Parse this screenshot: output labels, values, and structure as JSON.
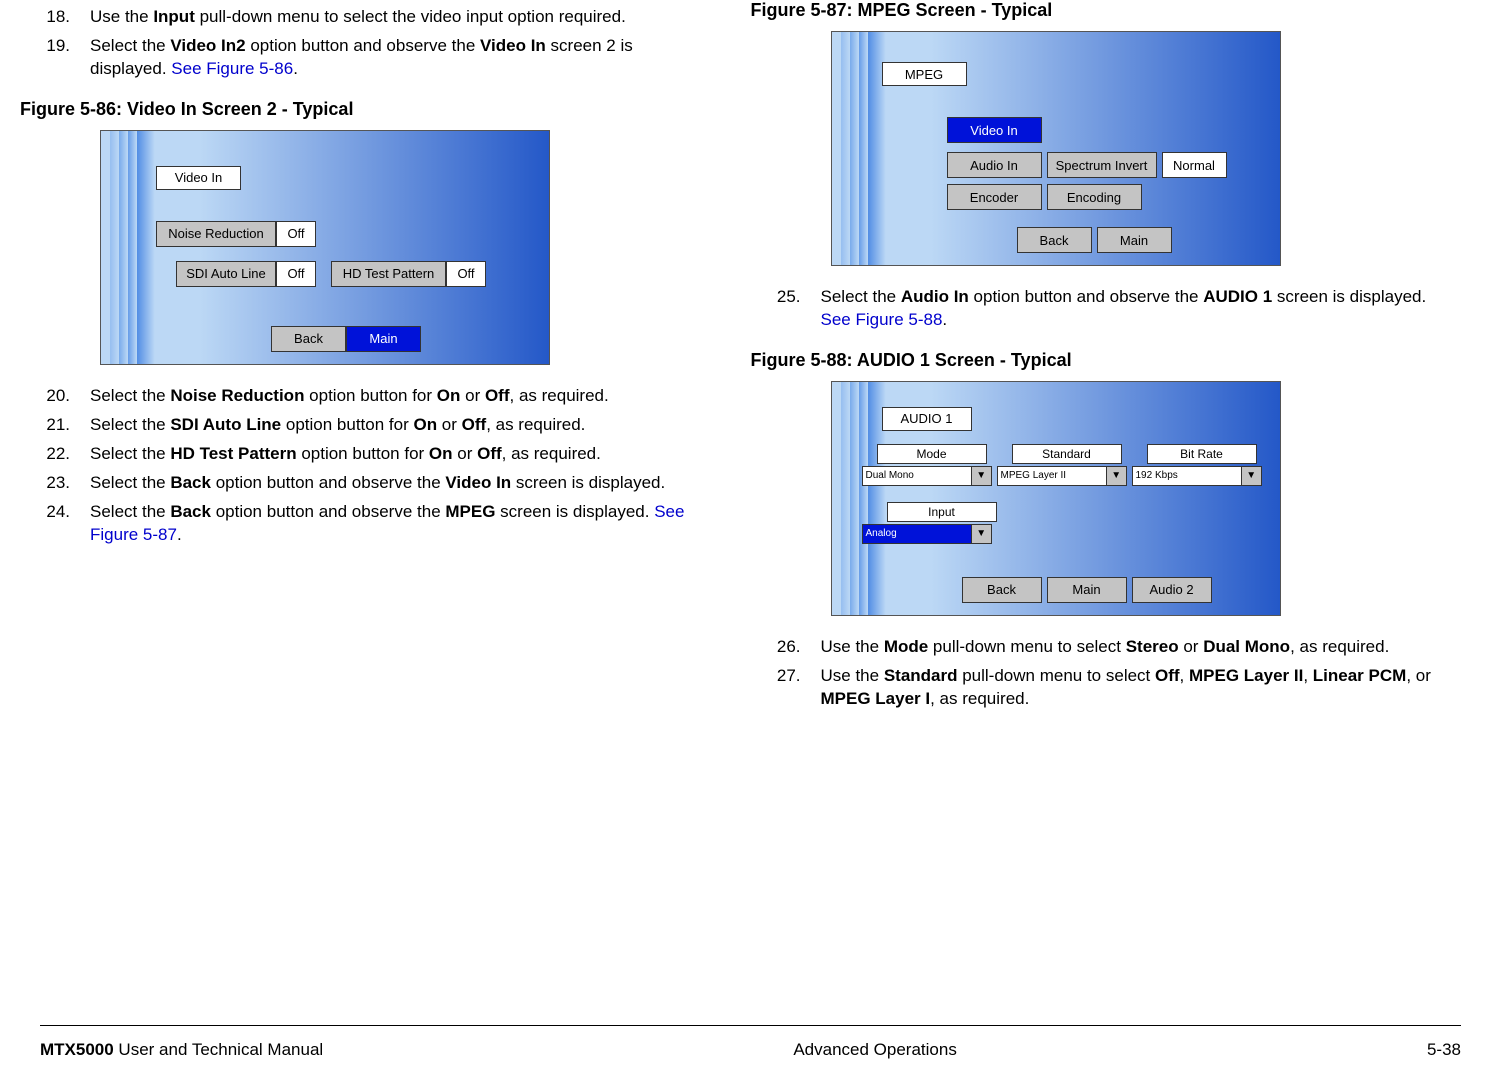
{
  "left": {
    "steps_a": [
      {
        "num": "18.",
        "html": "Use the <b>Input</b> pull-down menu to select the video input option required."
      },
      {
        "num": "19.",
        "html": "Select the <b>Video In2</b> option button and observe the <b>Video In</b> screen 2 is displayed.  <span class='link'>See Figure 5-86</span>."
      }
    ],
    "fig86_title": "Figure 5-86:   Video In Screen 2 - Typical",
    "fig86": {
      "tab": "Video In",
      "noise_reduction": "Noise Reduction",
      "off1": "Off",
      "sdi": "SDI Auto Line",
      "off2": "Off",
      "hdtest": "HD Test Pattern",
      "off3": "Off",
      "back": "Back",
      "main": "Main"
    },
    "steps_b": [
      {
        "num": "20.",
        "html": "Select the <b>Noise Reduction</b> option button for <b>On</b> or <b>Off</b>, as required."
      },
      {
        "num": "21.",
        "html": "Select the <b>SDI Auto Line</b> option button for <b>On</b> or <b>Off</b>, as required."
      },
      {
        "num": "22.",
        "html": "Select the <b>HD Test Pattern</b> option button for <b>On</b> or <b>Off</b>, as required."
      },
      {
        "num": "23.",
        "html": "Select the <b>Back</b> option button and observe the <b>Video In</b> screen is displayed."
      },
      {
        "num": "24.",
        "html": "Select the <b>Back</b> option button and observe the <b>MPEG</b> screen is displayed.  <span class='link'>See Figure 5-87</span>."
      }
    ]
  },
  "right": {
    "fig87_title": "Figure 5-87:   MPEG Screen - Typical",
    "fig87": {
      "mpeg": "MPEG",
      "video_in": "Video In",
      "audio_in": "Audio In",
      "spec": "Spectrum Invert",
      "normal": "Normal",
      "encoder": "Encoder",
      "encoding": "Encoding",
      "back": "Back",
      "main": "Main"
    },
    "steps_a": [
      {
        "num": "25.",
        "html": "Select the <b>Audio In</b> option button and observe the <b>AUDIO 1</b> screen is displayed.  <span class='link'>See Figure 5-88</span>."
      }
    ],
    "fig88_title": "Figure 5-88:   AUDIO 1 Screen - Typical",
    "fig88": {
      "tab": "AUDIO 1",
      "mode": "Mode",
      "standard": "Standard",
      "bitrate": "Bit Rate",
      "dual": "Dual Mono",
      "layer": "MPEG Layer II",
      "kbps": "192 Kbps",
      "input": "Input",
      "analog": "Analog",
      "back": "Back",
      "main": "Main",
      "audio2": "Audio 2"
    },
    "steps_b": [
      {
        "num": "26.",
        "html": "Use the <b>Mode</b> pull-down menu to select <b>Stereo</b> or <b>Dual Mono</b>, as required."
      },
      {
        "num": "27.",
        "html": "Use the <b>Standard</b> pull-down menu to select <b>Off</b>, <b>MPEG Layer II</b>, <b>Linear PCM</b>, or <b>MPEG Layer I</b>, as required."
      }
    ]
  },
  "footer": {
    "left_bold": "MTX5000",
    "left_rest": " User and Technical Manual",
    "center": "Advanced Operations",
    "right": "5-38"
  }
}
